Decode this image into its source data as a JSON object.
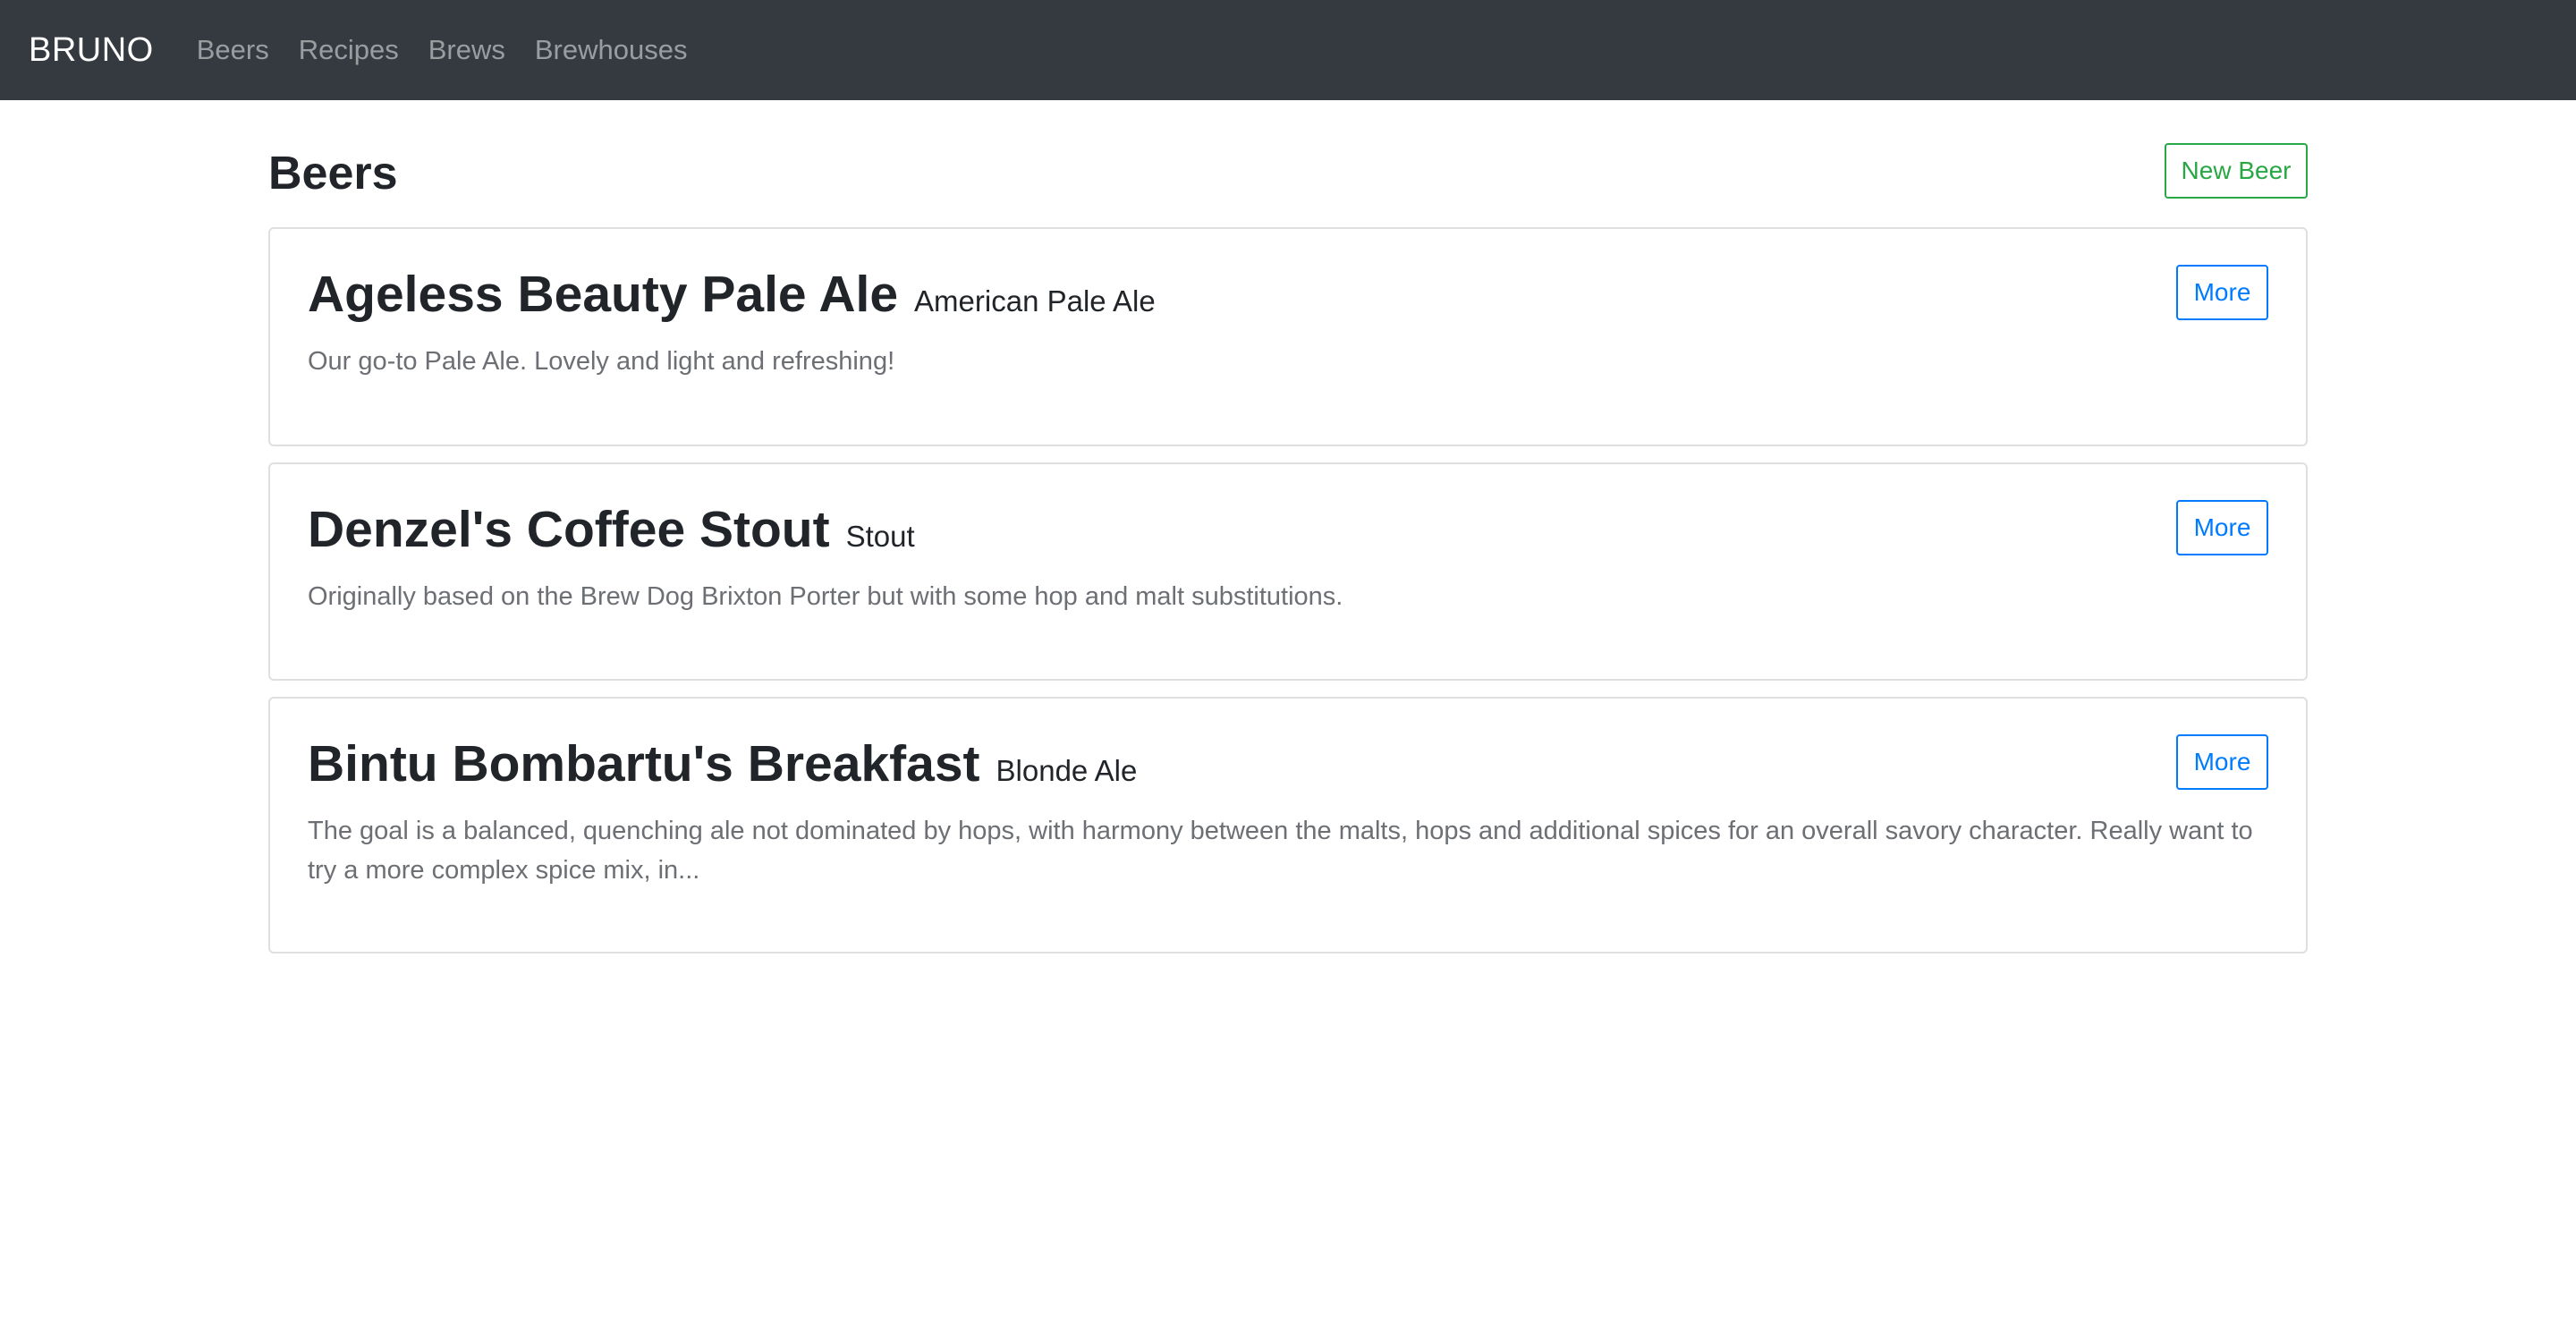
{
  "navbar": {
    "brand": "BRUNO",
    "links": [
      "Beers",
      "Recipes",
      "Brews",
      "Brewhouses"
    ]
  },
  "page": {
    "title": "Beers",
    "new_button_label": "New Beer"
  },
  "beers": [
    {
      "name": "Ageless Beauty Pale Ale",
      "style": "American Pale Ale",
      "description": "Our go-to Pale Ale. Lovely and light and refreshing!",
      "more_label": "More"
    },
    {
      "name": "Denzel's Coffee Stout",
      "style": "Stout",
      "description": "Originally based on the Brew Dog Brixton Porter but with some hop and malt substitutions.",
      "more_label": "More"
    },
    {
      "name": "Bintu Bombartu's Breakfast",
      "style": "Blonde Ale",
      "description": "The goal is a balanced, quenching ale not dominated by hops, with harmony between the malts, hops and additional spices for an overall savory character. Really want to try a more complex spice mix, in...",
      "more_label": "More"
    }
  ],
  "colors": {
    "navbar_bg": "#343a40",
    "success": "#28a745",
    "primary": "#007bff"
  }
}
